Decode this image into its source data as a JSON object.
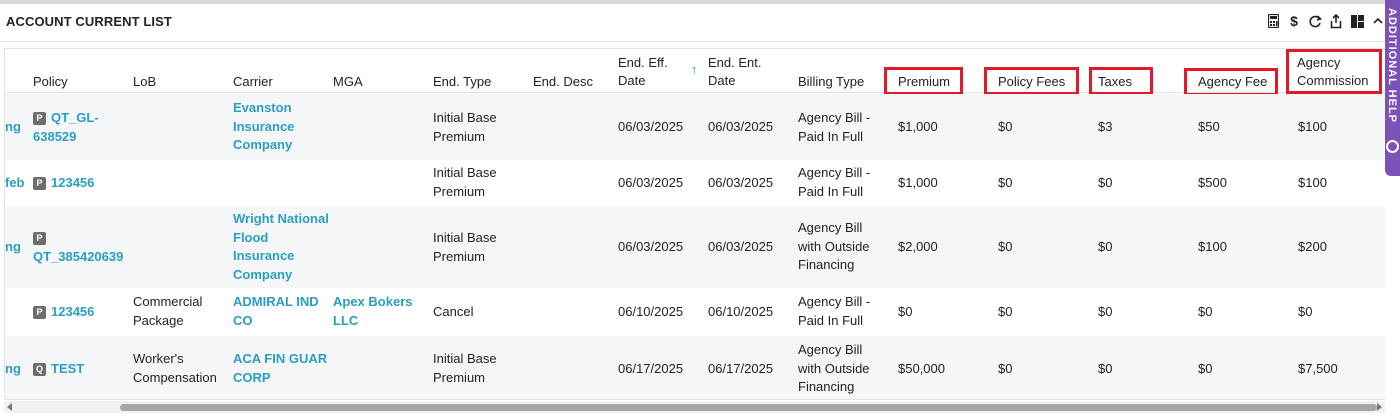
{
  "panel": {
    "title": "ACCOUNT CURRENT LIST",
    "side_tab_label": "ADDITIONAL HELP",
    "icons": [
      "calculator-icon",
      "dollar-icon",
      "refresh-icon",
      "export-icon",
      "layout-icon",
      "chevron-up-icon"
    ],
    "highlight_color": "#e0192b",
    "link_color": "#2a9fc3",
    "side_tab_color": "#7b52b8"
  },
  "columns": {
    "policy": "Policy",
    "lob": "LoB",
    "carrier": "Carrier",
    "mga": "MGA",
    "end_type": "End. Type",
    "end_desc": "End. Desc",
    "end_eff_date": "End. Eff. Date",
    "end_ent_date": "End. Ent. Date",
    "billing_type": "Billing Type",
    "premium": "Premium",
    "policy_fees": "Policy Fees",
    "taxes": "Taxes",
    "agency_fee": "Agency Fee",
    "agency_commission": "Agency Commission"
  },
  "rows": [
    {
      "left_fragment": "ng",
      "badge": "P",
      "policy": "QT_GL-638529",
      "lob": "",
      "carrier": "Evanston Insurance Company",
      "mga": "",
      "end_type": "Initial Base Premium",
      "end_desc": "",
      "end_eff_date": "06/03/2025",
      "end_ent_date": "06/03/2025",
      "billing_type": "Agency Bill - Paid In Full",
      "premium": "$1,000",
      "policy_fees": "$0",
      "taxes": "$3",
      "agency_fee": "$50",
      "agency_commission": "$100"
    },
    {
      "left_fragment": "feb",
      "badge": "P",
      "policy": "123456",
      "lob": "",
      "carrier": "",
      "mga": "",
      "end_type": "Initial Base Premium",
      "end_desc": "",
      "end_eff_date": "06/03/2025",
      "end_ent_date": "06/03/2025",
      "billing_type": "Agency Bill - Paid In Full",
      "premium": "$1,000",
      "policy_fees": "$0",
      "taxes": "$0",
      "agency_fee": "$500",
      "agency_commission": "$100"
    },
    {
      "left_fragment": "ng",
      "badge": "P",
      "policy": "QT_385420639",
      "lob": "",
      "carrier": "Wright National Flood Insurance Company",
      "mga": "",
      "end_type": "Initial Base Premium",
      "end_desc": "",
      "end_eff_date": "06/03/2025",
      "end_ent_date": "06/03/2025",
      "billing_type": "Agency Bill with Outside Financing",
      "premium": "$2,000",
      "policy_fees": "$0",
      "taxes": "$0",
      "agency_fee": "$100",
      "agency_commission": "$200"
    },
    {
      "left_fragment": "",
      "badge": "P",
      "policy": "123456",
      "lob": "Commercial Package",
      "carrier": "ADMIRAL IND CO",
      "mga": "Apex Bokers LLC",
      "end_type": "Cancel",
      "end_desc": "",
      "end_eff_date": "06/10/2025",
      "end_ent_date": "06/10/2025",
      "billing_type": "Agency Bill - Paid In Full",
      "premium": "$0",
      "policy_fees": "$0",
      "taxes": "$0",
      "agency_fee": "$0",
      "agency_commission": "$0"
    },
    {
      "left_fragment": "ng",
      "badge": "Q",
      "policy": "TEST",
      "lob": "Worker's Compensation",
      "carrier": "ACA FIN GUAR CORP",
      "mga": "",
      "end_type": "Initial Base Premium",
      "end_desc": "",
      "end_eff_date": "06/17/2025",
      "end_ent_date": "06/17/2025",
      "billing_type": "Agency Bill with Outside Financing",
      "premium": "$50,000",
      "policy_fees": "$0",
      "taxes": "$0",
      "agency_fee": "$0",
      "agency_commission": "$7,500"
    }
  ]
}
